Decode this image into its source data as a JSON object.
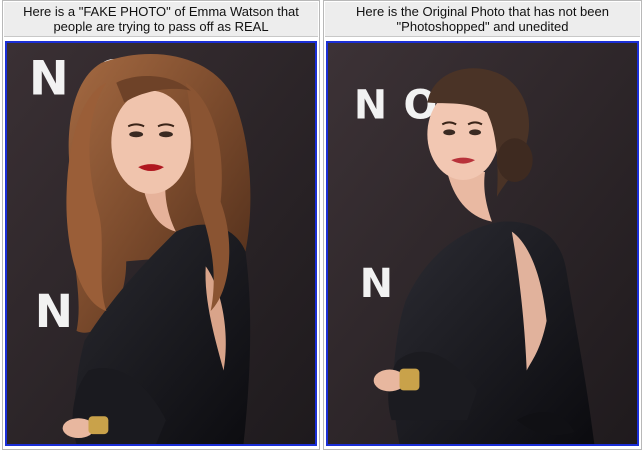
{
  "panels": [
    {
      "caption": "Here is a \"FAKE PHOTO\" of Emma Watson that people are trying to pass off as REAL",
      "backdrop_letters": [
        "N",
        "O",
        "N"
      ],
      "colors": {
        "backdrop": "#2a2326",
        "hair": "#8a5634",
        "dress": "#16161a",
        "lips": "#b01820",
        "frame": "#1b2fd6"
      }
    },
    {
      "caption": "Here is the Original Photo that has not been \"Photoshopped\" and unedited",
      "backdrop_letters": [
        "N",
        "O",
        "N"
      ],
      "colors": {
        "backdrop": "#2c2528",
        "hair": "#4a3326",
        "dress": "#141418",
        "lips": "#b8323a",
        "frame": "#1b2fd6"
      }
    }
  ]
}
